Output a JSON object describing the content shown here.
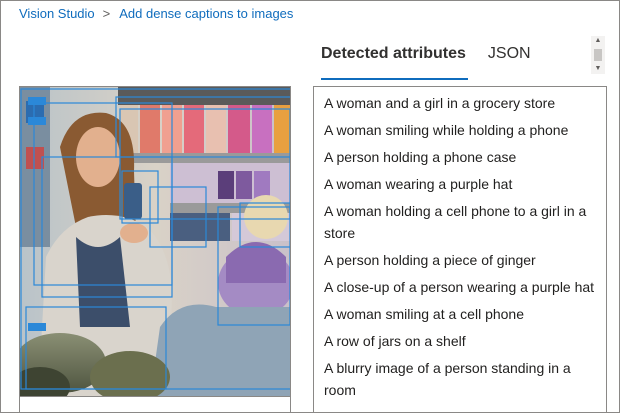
{
  "breadcrumb": {
    "root": "Vision Studio",
    "separator": ">",
    "current": "Add dense captions to images"
  },
  "tabs": [
    {
      "label": "Detected attributes",
      "active": true
    },
    {
      "label": "JSON",
      "active": false
    }
  ],
  "attributes": [
    "A woman and a girl in a grocery store",
    "A woman smiling while holding a phone",
    "A person holding a phone case",
    "A woman wearing a purple hat",
    "A woman holding a cell phone to a girl in a store",
    "A person holding a piece of ginger",
    "A close-up of a person wearing a purple hat",
    "A woman smiling at a cell phone",
    "A row of jars on a shelf",
    "A blurry image of a person standing in a room"
  ],
  "colors": {
    "accent": "#0f6cbd",
    "bounding_box": "#2b88d8",
    "border": "#8a8886"
  }
}
